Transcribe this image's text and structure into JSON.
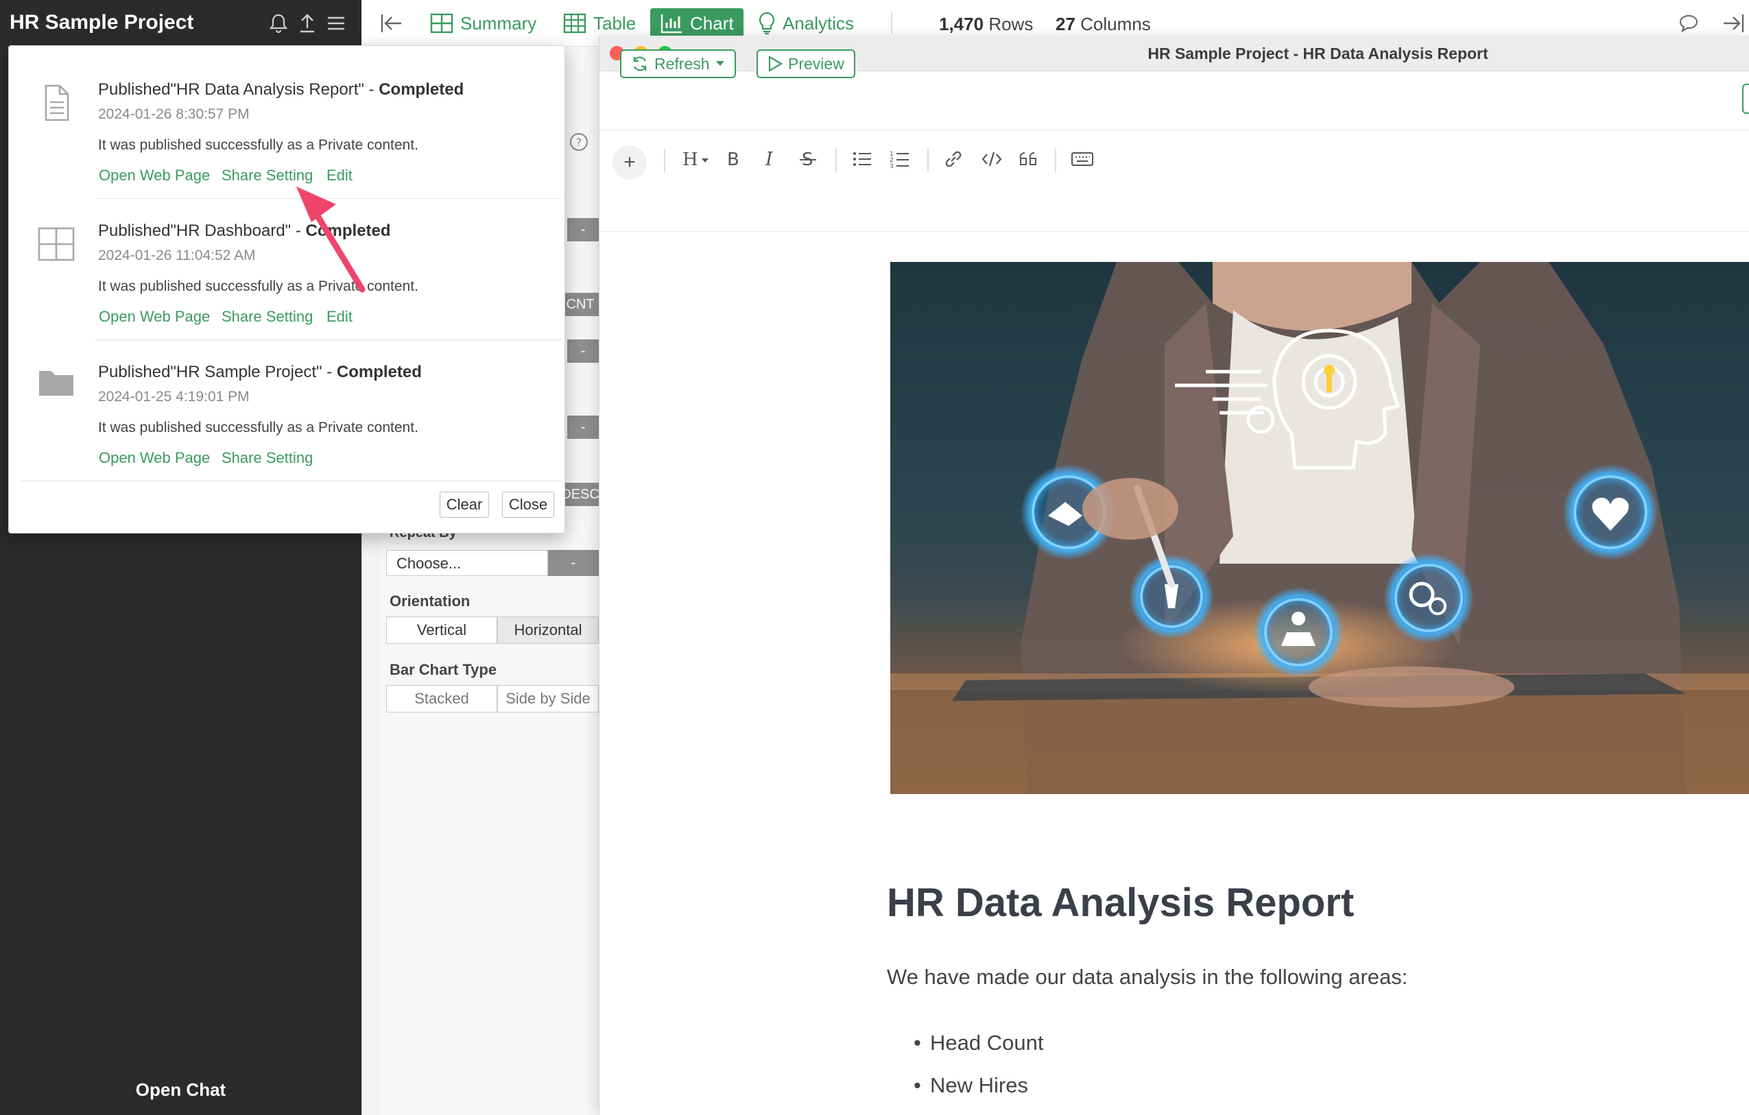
{
  "sidebar": {
    "project_title": "HR Sample Project",
    "open_chat_label": "Open Chat"
  },
  "toolbar": {
    "summary_label": "Summary",
    "table_label": "Table",
    "chart_label": "Chart",
    "analytics_label": "Analytics",
    "rows_count": "1,470",
    "rows_label": "Rows",
    "columns_count": "27",
    "columns_label": "Columns"
  },
  "settings_pane": {
    "stub_cnt": "CNT",
    "stub_desc": "DESC",
    "stub_dash": "-",
    "repeat_by_label": "Repeat By",
    "choose_value": "Choose...",
    "orientation_label": "Orientation",
    "orientation_options": [
      "Vertical",
      "Horizontal"
    ],
    "orientation_selected": "Horizontal",
    "bar_chart_type_label": "Bar Chart Type",
    "bar_chart_type_options": [
      "Stacked",
      "Side by Side"
    ]
  },
  "popup": {
    "notifications": [
      {
        "icon": "document-icon",
        "title_prefix": "Published\"HR Data Analysis Report\" - ",
        "status": "Completed",
        "timestamp": "2024-01-26 8:30:57 PM",
        "message": "It was published successfully as a Private content.",
        "links": [
          "Open Web Page",
          "Share Setting",
          "Edit"
        ]
      },
      {
        "icon": "dashboard-icon",
        "title_prefix": "Published\"HR Dashboard\" - ",
        "status": "Completed",
        "timestamp": "2024-01-26 11:04:52 AM",
        "message": "It was published successfully as a Private content.",
        "links": [
          "Open Web Page",
          "Share Setting",
          "Edit"
        ]
      },
      {
        "icon": "folder-icon",
        "title_prefix": "Published\"HR Sample Project\" - ",
        "status": "Completed",
        "timestamp": "2024-01-25 4:19:01 PM",
        "message": "It was published successfully as a Private content.",
        "links": [
          "Open Web Page",
          "Share Setting"
        ]
      }
    ],
    "clear_label": "Clear",
    "close_label": "Close"
  },
  "document": {
    "window_title": "HR Sample Project - HR Data Analysis Report",
    "refresh_label": "Refresh",
    "preview_label": "Preview",
    "heading": "HR Data Analysis Report",
    "intro": "We have made our data analysis in the following areas:",
    "bullets": [
      "Head Count",
      "New Hires"
    ]
  },
  "colors": {
    "accent_green": "#3a9b5e",
    "sidebar_dark": "#2b2b2b",
    "annotation_arrow": "#f0456b"
  }
}
